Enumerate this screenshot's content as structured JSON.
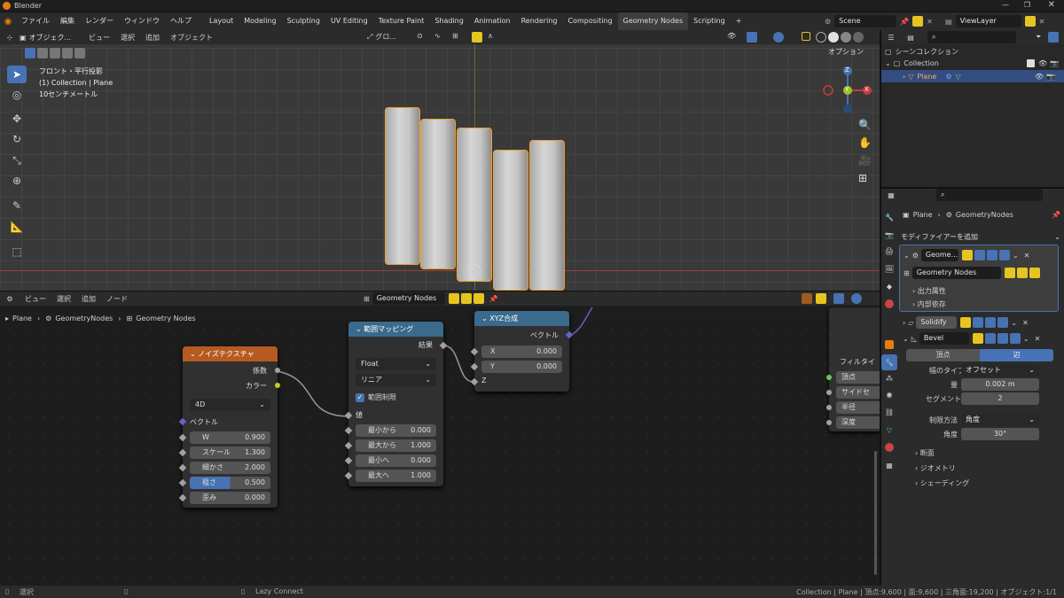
{
  "window": {
    "title": "Blender"
  },
  "menu": [
    "ファイル",
    "編集",
    "レンダー",
    "ウィンドウ",
    "ヘルプ"
  ],
  "workspaces": [
    "Layout",
    "Modeling",
    "Sculpting",
    "UV Editing",
    "Texture Paint",
    "Shading",
    "Animation",
    "Rendering",
    "Compositing",
    "Geometry Nodes",
    "Scripting",
    "+"
  ],
  "active_workspace": "Geometry Nodes",
  "scene": {
    "name": "Scene",
    "view_layer": "ViewLayer"
  },
  "viewport": {
    "mode": "オブジェク...",
    "menus": [
      "ビュー",
      "選択",
      "追加",
      "オブジェクト"
    ],
    "transform": "グロ...",
    "options": "オプション",
    "overlay": [
      "フロント・平行投影",
      "(1) Collection | Plane",
      "10センチメートル"
    ],
    "gizmo": {
      "x": "X",
      "y": "Y",
      "z": "Z"
    }
  },
  "outliner": {
    "root": "シーンコレクション",
    "collection": "Collection",
    "object": "Plane"
  },
  "properties": {
    "breadcrumb": [
      "Plane",
      "GeometryNodes"
    ],
    "add_modifier": "モディファイアーを追加",
    "modifiers": {
      "geo_name": "Geome...",
      "geo_tree": "Geometry Nodes",
      "geo_sub": [
        "出力属性",
        "内部依存"
      ],
      "solidify": "Solidify",
      "bevel": "Bevel",
      "bevel_tabs": [
        "頂点",
        "辺"
      ],
      "bevel_active_tab": "辺",
      "width_type_label": "幅のタイプ",
      "width_type": "オフセット",
      "amount_label": "量",
      "amount": "0.002 m",
      "segments_label": "セグメント",
      "segments": "2",
      "limit_label": "制限方法",
      "limit": "角度",
      "angle_label": "角度",
      "angle": "30°",
      "sections": [
        "断面",
        "ジオメトリ",
        "シェーディング"
      ]
    }
  },
  "node_editor": {
    "menus": [
      "ビュー",
      "選択",
      "追加",
      "ノード"
    ],
    "tree": "Geometry Nodes",
    "breadcrumb": [
      "Plane",
      "GeometryNodes",
      "Geometry Nodes"
    ],
    "noise": {
      "title": "ノイズテクスチャ",
      "out_fac": "係数",
      "out_color": "カラー",
      "dim": "4D",
      "vector": "ベクトル",
      "inputs": [
        {
          "label": "W",
          "value": "0.900"
        },
        {
          "label": "スケール",
          "value": "1.300"
        },
        {
          "label": "細かさ",
          "value": "2.000"
        },
        {
          "label": "粗さ",
          "value": "0.500"
        },
        {
          "label": "歪み",
          "value": "0.000"
        }
      ]
    },
    "maprange": {
      "title": "範囲マッピング",
      "out": "結果",
      "type": "Float",
      "interp": "リニア",
      "clamp": "範囲制限",
      "value": "値",
      "inputs": [
        {
          "label": "最小から",
          "value": "0.000"
        },
        {
          "label": "最大から",
          "value": "1.000"
        },
        {
          "label": "最小へ",
          "value": "0.000"
        },
        {
          "label": "最大へ",
          "value": "1.000"
        }
      ]
    },
    "combine": {
      "title": "XYZ合成",
      "out": "ベクトル",
      "x_label": "X",
      "x": "0.000",
      "y_label": "Y",
      "y": "0.000",
      "z_label": "Z"
    },
    "partial": {
      "title": "フィルタイ",
      "items": [
        "頂点",
        "サイドセ",
        "半径",
        "深度"
      ]
    }
  },
  "status": {
    "left": "選択",
    "mid": "Lazy Connect",
    "right": "Collection | Plane | 頂点:9,600 | 面:9,600 | 三角面:19,200 | オブジェクト:1/1"
  }
}
